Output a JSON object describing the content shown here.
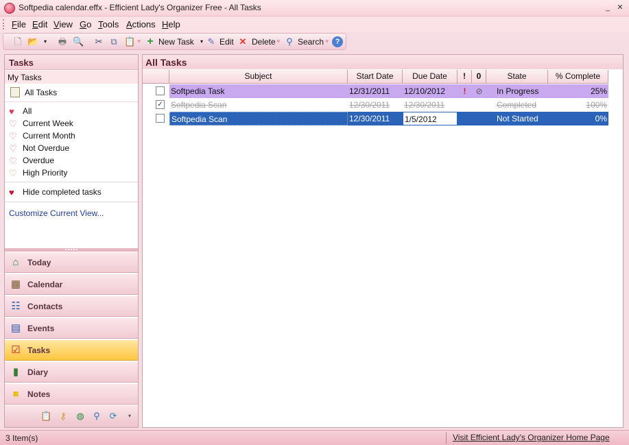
{
  "window": {
    "title": "Softpedia calendar.effx - Efficient Lady's Organizer Free - All Tasks"
  },
  "menu": [
    {
      "label": "File",
      "mnemonic": "F",
      "rest": "ile"
    },
    {
      "label": "Edit",
      "mnemonic": "E",
      "rest": "dit"
    },
    {
      "label": "View",
      "mnemonic": "V",
      "rest": "iew"
    },
    {
      "label": "Go",
      "mnemonic": "G",
      "rest": "o"
    },
    {
      "label": "Tools",
      "mnemonic": "T",
      "rest": "ools"
    },
    {
      "label": "Actions",
      "mnemonic": "A",
      "rest": "ctions"
    },
    {
      "label": "Help",
      "mnemonic": "H",
      "rest": "elp"
    }
  ],
  "toolbar": {
    "new_task": "New Task",
    "edit": "Edit",
    "delete": "Delete",
    "search": "Search"
  },
  "left": {
    "header": "Tasks",
    "section": "My Tasks",
    "all_tasks": "All Tasks",
    "filters": [
      {
        "label": "All",
        "color": "#d93a5c"
      },
      {
        "label": "Current Week",
        "color": "#e86a8a"
      },
      {
        "label": "Current Month",
        "color": "#e86a8a"
      },
      {
        "label": "Not Overdue",
        "color": "#e86a8a"
      },
      {
        "label": "Overdue",
        "color": "#e86a8a"
      },
      {
        "label": "High Priority",
        "color": "#e89a4a"
      }
    ],
    "hide_completed": "Hide completed tasks",
    "customize": "Customize Current View..."
  },
  "nav": [
    {
      "label": "Today",
      "icon": "home-icon",
      "active": false
    },
    {
      "label": "Calendar",
      "icon": "calendar-icon",
      "active": false
    },
    {
      "label": "Contacts",
      "icon": "contacts-icon",
      "active": false
    },
    {
      "label": "Events",
      "icon": "events-icon",
      "active": false
    },
    {
      "label": "Tasks",
      "icon": "tasks-icon",
      "active": true
    },
    {
      "label": "Diary",
      "icon": "diary-icon",
      "active": false
    },
    {
      "label": "Notes",
      "icon": "notes-icon",
      "active": false
    }
  ],
  "main": {
    "header": "All Tasks",
    "columns": {
      "subject": "Subject",
      "start": "Start Date",
      "due": "Due Date",
      "priority": "!",
      "attach": "0",
      "state": "State",
      "complete": "% Complete"
    },
    "rows": [
      {
        "subject": "Softpedia Task",
        "start": "12/31/2011",
        "due": "12/10/2012",
        "state": "In Progress",
        "complete": "25%",
        "checked": false,
        "style": "purple"
      },
      {
        "subject": "Softpedia Scan",
        "start": "12/30/2011",
        "due": "12/30/2011",
        "state": "Completed",
        "complete": "100%",
        "checked": true,
        "style": "done"
      },
      {
        "subject": "Softpedia Scan",
        "start": "12/30/2011",
        "due": "1/5/2012",
        "state": "Not Started",
        "complete": "0%",
        "checked": false,
        "style": "blue"
      }
    ]
  },
  "status": {
    "count": "3 Item(s)",
    "link": "Visit Efficient Lady's Organizer Home Page"
  }
}
